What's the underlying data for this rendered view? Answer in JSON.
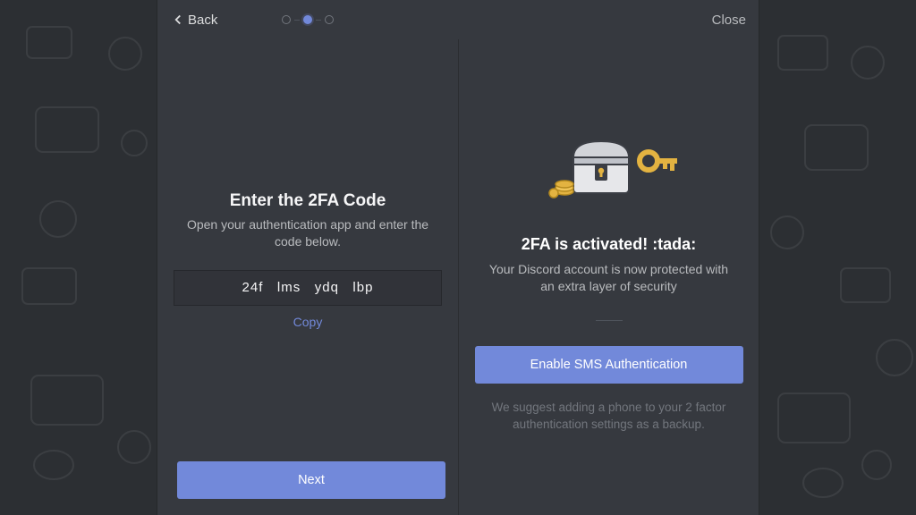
{
  "header": {
    "back_label": "Back",
    "close_label": "Close"
  },
  "stepper": {
    "total": 3,
    "active_index": 1
  },
  "left": {
    "title": "Enter the 2FA Code",
    "subtitle": "Open your authentication app and enter the code below.",
    "code_value": "24f   lms   ydq   lbp",
    "copy_label": "Copy",
    "next_label": "Next"
  },
  "right": {
    "title": "2FA is activated! :tada:",
    "subtitle": "Your Discord account is now protected with an extra layer of security",
    "sms_button_label": "Enable SMS Authentication",
    "hint": "We suggest adding a phone to your 2 factor authentication settings as a backup."
  },
  "colors": {
    "accent": "#7289da",
    "gold": "#e3b341"
  }
}
